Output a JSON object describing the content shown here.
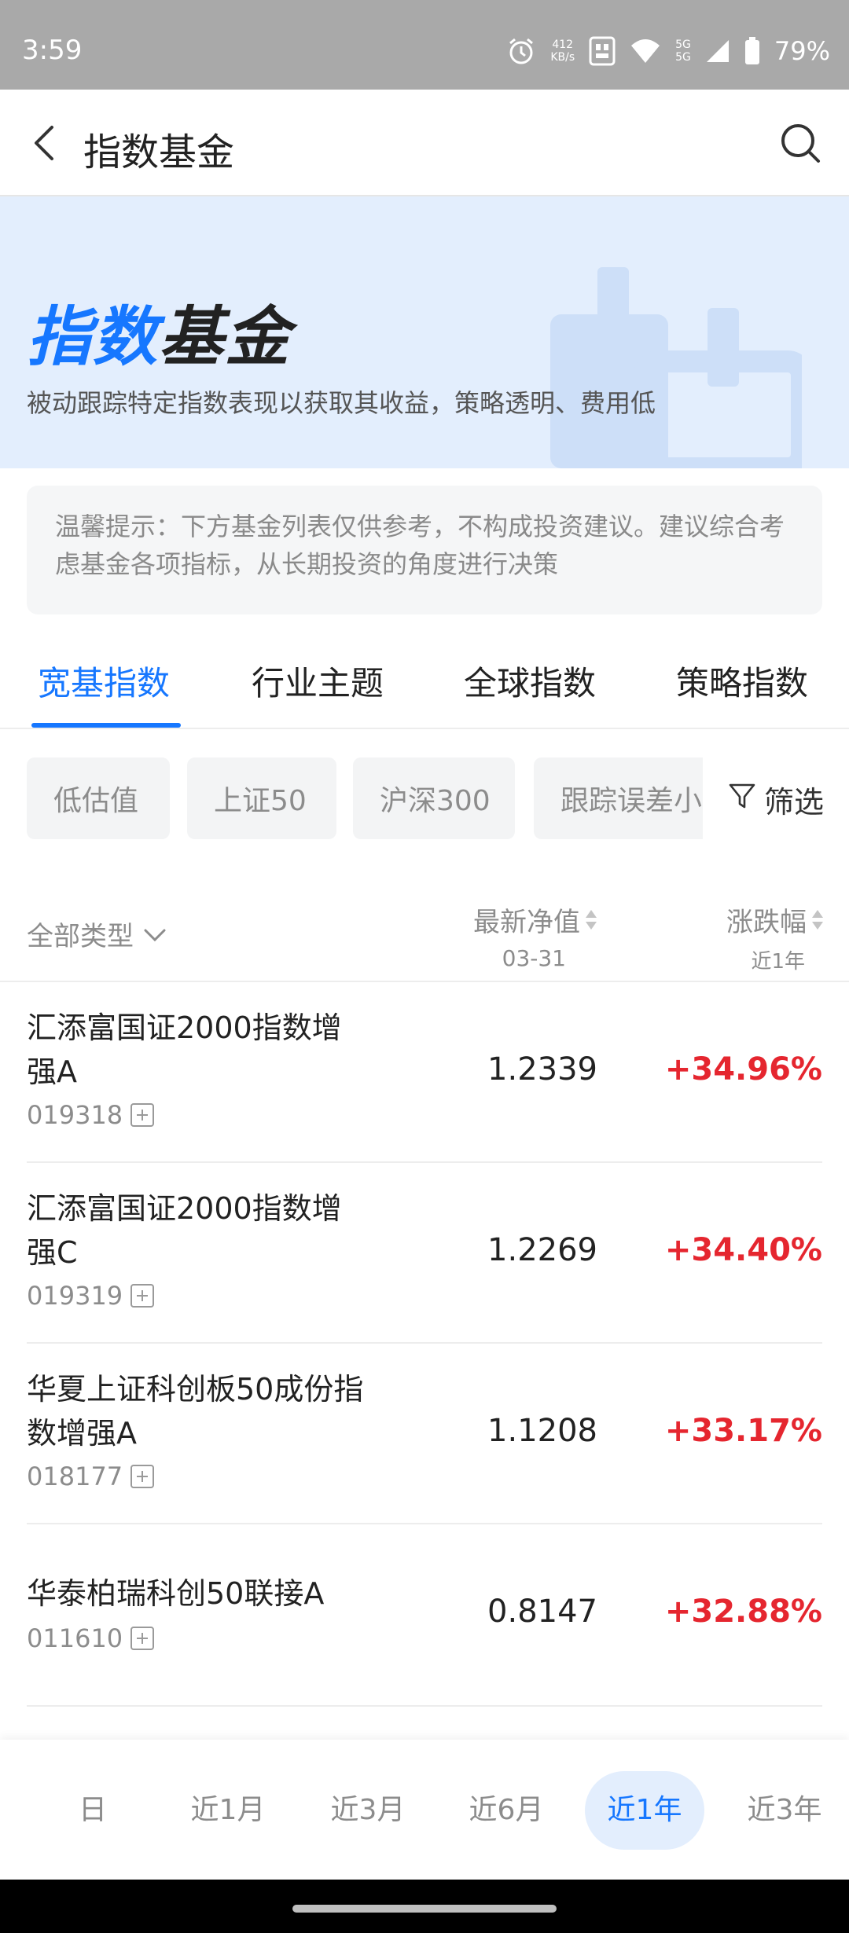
{
  "status_bar": {
    "time": "3:59",
    "net_speed_value": "412",
    "net_speed_unit": "KB/s",
    "network": "5G",
    "battery": "79%"
  },
  "header": {
    "title": "指数基金"
  },
  "banner": {
    "title_highlight": "指数",
    "title_rest": "基金",
    "subtitle": "被动跟踪特定指数表现以获取其收益，策略透明、费用低"
  },
  "notice": {
    "text": "温馨提示：下方基金列表仅供参考，不构成投资建议。建议综合考虑基金各项指标，从长期投资的角度进行决策"
  },
  "tabs": [
    {
      "label": "宽基指数",
      "active": true
    },
    {
      "label": "行业主题",
      "active": false
    },
    {
      "label": "全球指数",
      "active": false
    },
    {
      "label": "策略指数",
      "active": false
    }
  ],
  "chips": [
    "低估值",
    "上证50",
    "沪深300",
    "跟踪误差小"
  ],
  "filter_label": "筛选",
  "list_header": {
    "type_select": "全部类型",
    "nav_label": "最新净值",
    "nav_date": "03-31",
    "change_label": "涨跌幅",
    "change_period": "近1年"
  },
  "funds": [
    {
      "name": "汇添富国证2000指数增强A",
      "code": "019318",
      "nav": "1.2339",
      "change": "+34.96%"
    },
    {
      "name": "汇添富国证2000指数增强C",
      "code": "019319",
      "nav": "1.2269",
      "change": "+34.40%"
    },
    {
      "name": "华夏上证科创板50成份指数增强A",
      "code": "018177",
      "nav": "1.1208",
      "change": "+33.17%"
    },
    {
      "name": "华泰柏瑞科创50联接A",
      "code": "011610",
      "nav": "0.8147",
      "change": "+32.88%"
    }
  ],
  "periods": [
    {
      "label": "日",
      "active": false
    },
    {
      "label": "近1月",
      "active": false
    },
    {
      "label": "近3月",
      "active": false
    },
    {
      "label": "近6月",
      "active": false
    },
    {
      "label": "近1年",
      "active": true
    },
    {
      "label": "近3年",
      "active": false
    }
  ],
  "colors": {
    "accent": "#1677ff",
    "rise": "#e5262f",
    "banner_bg": "#e3eefd"
  }
}
